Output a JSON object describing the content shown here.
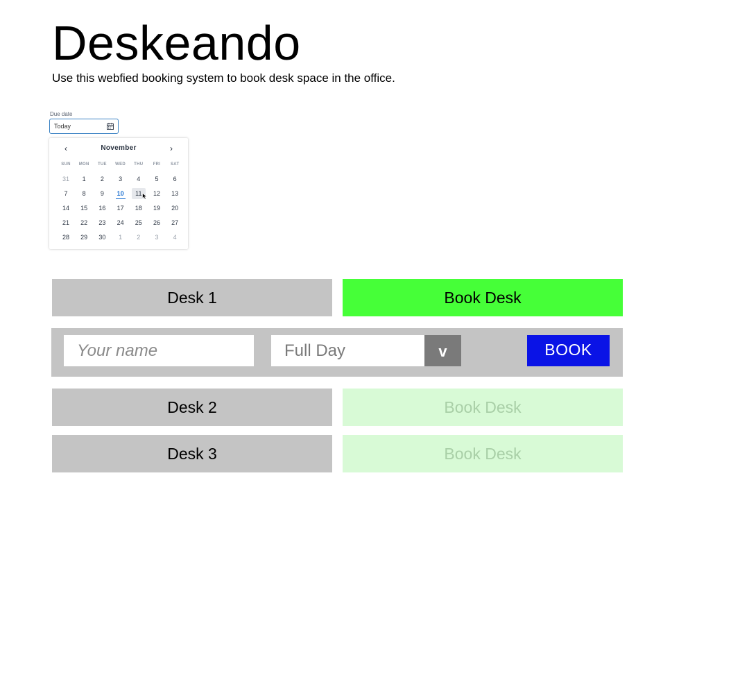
{
  "header": {
    "title": "Deskeando",
    "subtitle": "Use this webfied booking system to book desk space in the office."
  },
  "date_picker": {
    "label": "Due date",
    "value": "Today",
    "icon": "calendar-icon",
    "calendar": {
      "month": "November",
      "prev_icon": "chevron-left-icon",
      "next_icon": "chevron-right-icon",
      "prev_glyph": "‹",
      "next_glyph": "›",
      "weekdays": [
        "SUN",
        "MON",
        "TUE",
        "WED",
        "THU",
        "FRI",
        "SAT"
      ],
      "weeks": [
        [
          "31",
          "1",
          "2",
          "3",
          "4",
          "5",
          "6"
        ],
        [
          "7",
          "8",
          "9",
          "10",
          "11",
          "12",
          "13"
        ],
        [
          "14",
          "15",
          "16",
          "17",
          "18",
          "19",
          "20"
        ],
        [
          "21",
          "22",
          "23",
          "24",
          "25",
          "26",
          "27"
        ],
        [
          "28",
          "29",
          "30",
          "1",
          "2",
          "3",
          "4"
        ]
      ],
      "today": "10",
      "hovered": "11",
      "accent_color": "#1a6fd0"
    }
  },
  "desks": [
    {
      "label": "Desk 1",
      "action": "Book Desk",
      "state": "active"
    },
    {
      "label": "Desk 2",
      "action": "Book Desk",
      "state": "disabled"
    },
    {
      "label": "Desk 3",
      "action": "Book Desk",
      "state": "disabled"
    }
  ],
  "booking_form": {
    "name_placeholder": "Your name",
    "duration_value": "Full Day",
    "duration_toggle": "v",
    "submit_label": "BOOK"
  },
  "colors": {
    "book_active": "#46ff38",
    "book_disabled": "#d8fad6",
    "desk_gray": "#c4c4c4",
    "submit_blue": "#0a13e6"
  }
}
